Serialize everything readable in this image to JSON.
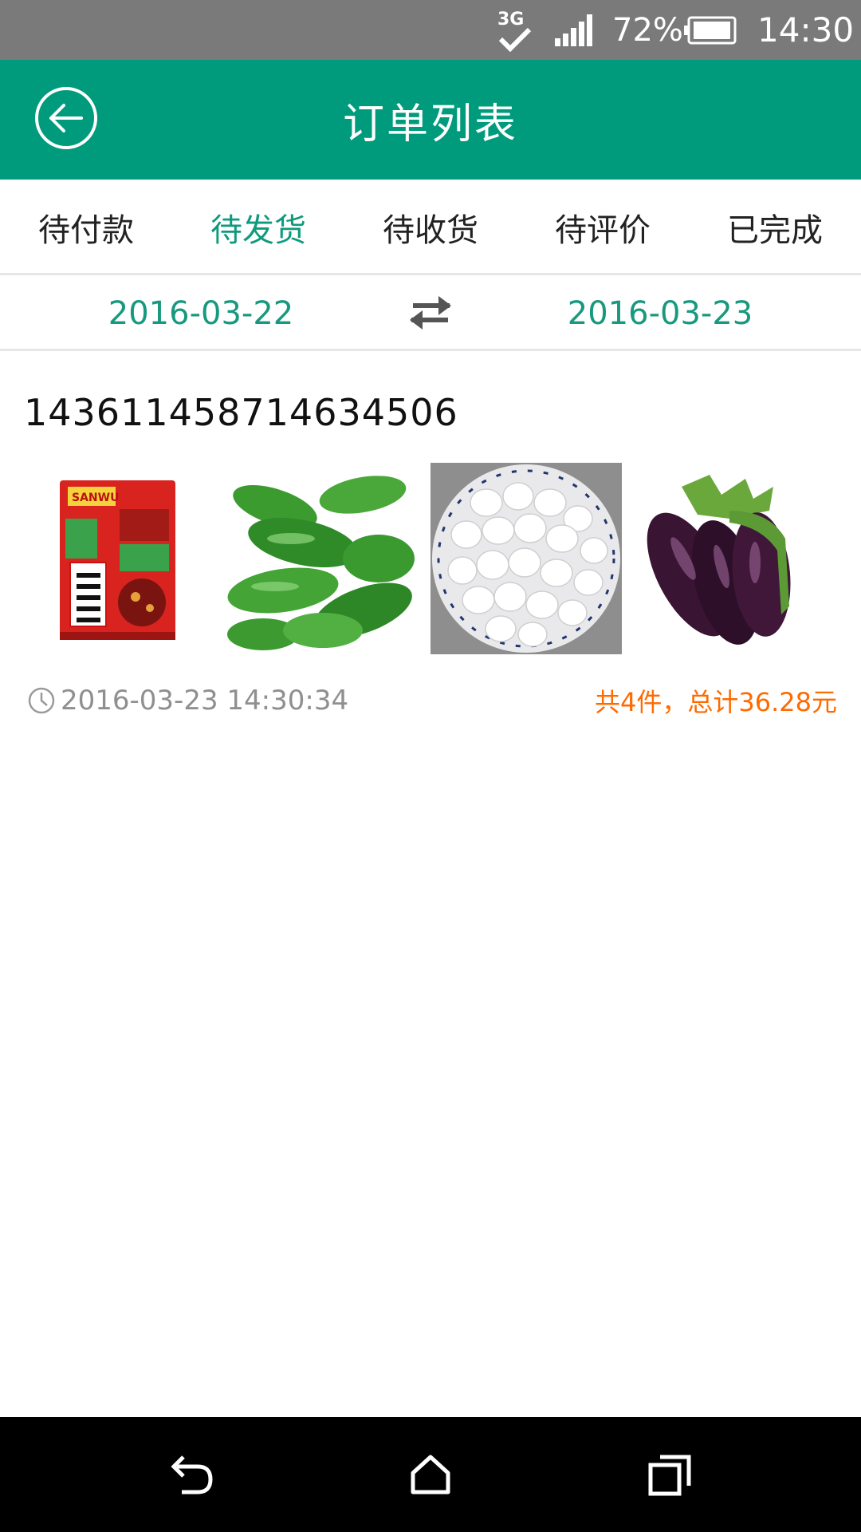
{
  "status_bar": {
    "network": "3G",
    "battery_percent": "72%",
    "time": "14:30"
  },
  "header": {
    "title": "订单列表",
    "back_icon": "back-arrow-icon"
  },
  "tabs": [
    {
      "label": "待付款",
      "active": false
    },
    {
      "label": "待发货",
      "active": true
    },
    {
      "label": "待收货",
      "active": false
    },
    {
      "label": "待评价",
      "active": false
    },
    {
      "label": "已完成",
      "active": false
    }
  ],
  "date_range": {
    "from": "2016-03-22",
    "to": "2016-03-23",
    "swap_icon": "swap-arrows-icon"
  },
  "order": {
    "number": "143611458714634506",
    "products": [
      {
        "name": "hotpot-seasoning-package"
      },
      {
        "name": "green-peppers"
      },
      {
        "name": "quail-eggs"
      },
      {
        "name": "eggplants"
      }
    ],
    "time": "2016-03-23 14:30:34",
    "summary": "共4件，总计36.28元"
  },
  "nav_bar": {
    "back_icon": "nav-back-icon",
    "home_icon": "nav-home-icon",
    "recents_icon": "nav-recents-icon"
  },
  "colors": {
    "primary": "#009b7d",
    "active_tab": "#0f9a7e",
    "date_text": "#17997d",
    "summary": "#ff6a00"
  }
}
